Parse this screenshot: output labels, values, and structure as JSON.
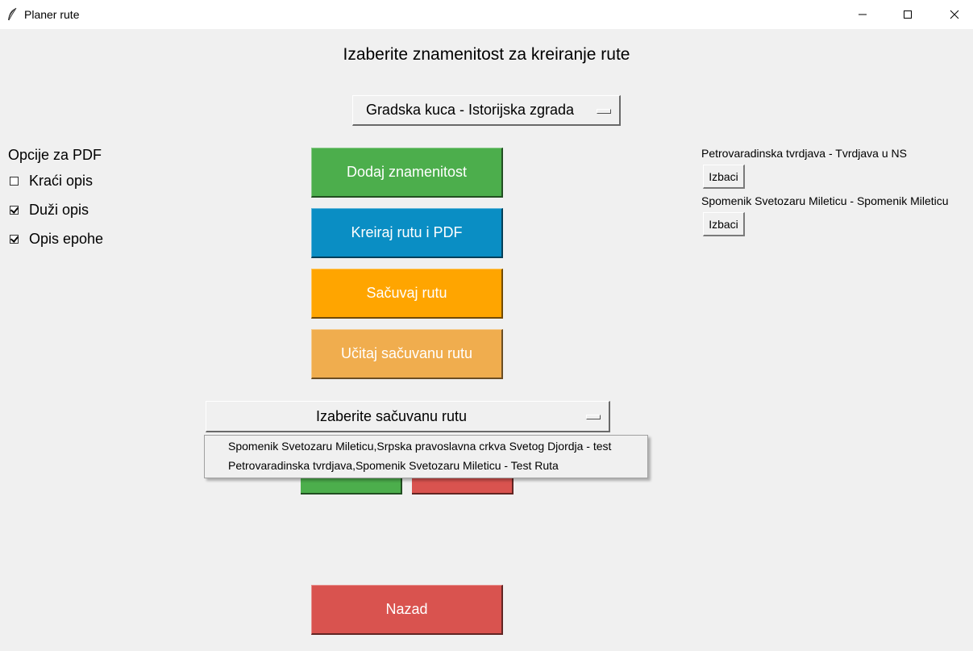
{
  "window": {
    "title": "Planer rute",
    "icon": "feather-icon",
    "controls": [
      "minimize-icon",
      "maximize-icon",
      "close-icon"
    ]
  },
  "heading": "Izaberite znamenitost za kreiranje rute",
  "landmark_select": {
    "value": "Gradska kuca - Istorijska zgrada"
  },
  "pdf_options": {
    "label": "Opcije za PDF",
    "items": [
      {
        "label": "Kraći opis",
        "checked": false
      },
      {
        "label": "Duži opis",
        "checked": true
      },
      {
        "label": "Opis epohe",
        "checked": true
      }
    ]
  },
  "buttons": {
    "add": {
      "label": "Dodaj znamenitost",
      "color": "#4cae4c"
    },
    "create": {
      "label": "Kreiraj rutu i PDF",
      "color": "#0a8ec4"
    },
    "save": {
      "label": "Sačuvaj rutu",
      "color": "#ffa500"
    },
    "load": {
      "label": "Učitaj sačuvanu rutu",
      "color": "#f0ad4e"
    },
    "back": {
      "label": "Nazad",
      "color": "#d9534f"
    }
  },
  "route_list": [
    {
      "name": "Petrovaradinska tvrdjava - Tvrdjava u NS",
      "remove_label": "Izbaci"
    },
    {
      "name": "Spomenik Svetozaru Mileticu - Spomenik Mileticu",
      "remove_label": "Izbaci"
    }
  ],
  "saved_route_select": {
    "value": "Izaberite sačuvanu rutu",
    "options": [
      "Spomenik Svetozaru Mileticu,Srpska pravoslavna crkva Svetog Djordja - test",
      "Petrovaradinska tvrdjava,Spomenik Svetozaru Mileticu - Test Ruta"
    ]
  }
}
